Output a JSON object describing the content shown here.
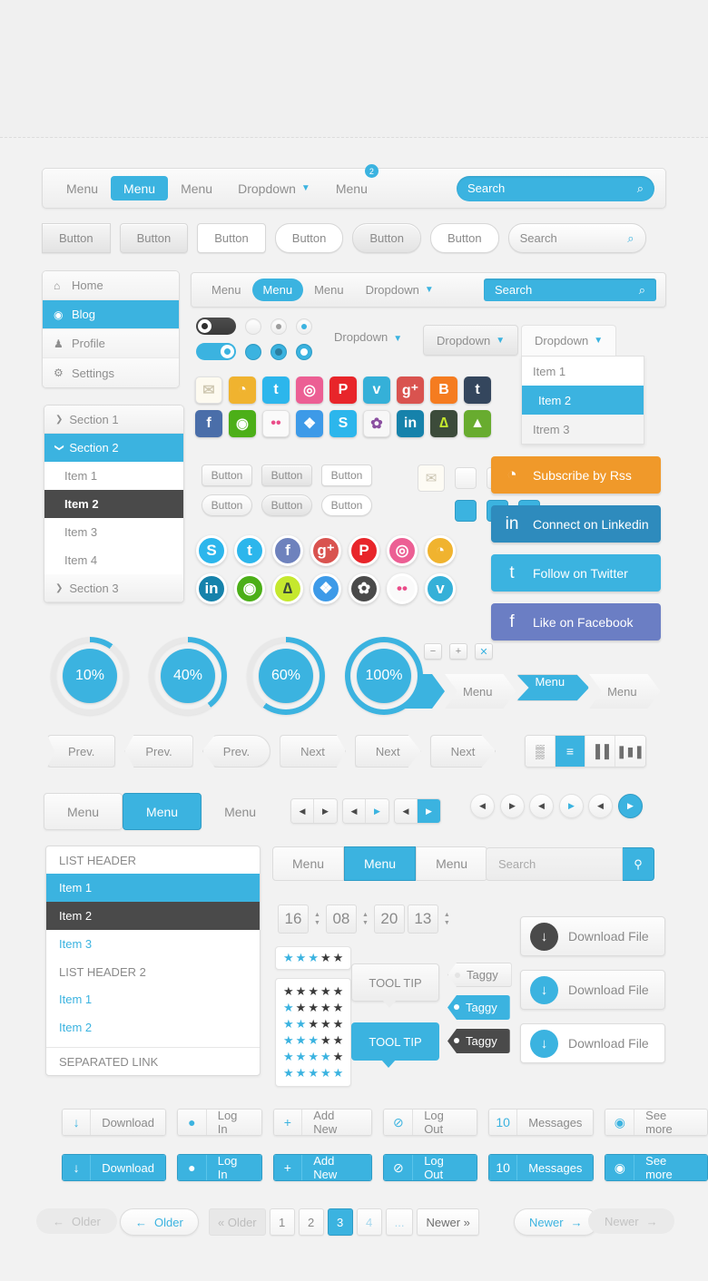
{
  "navbar_main": {
    "items": [
      {
        "label": "Menu",
        "active": false,
        "caret": false
      },
      {
        "label": "Menu",
        "active": true,
        "caret": false
      },
      {
        "label": "Menu",
        "active": false,
        "caret": false
      },
      {
        "label": "Dropdown",
        "active": false,
        "caret": true
      },
      {
        "label": "Menu",
        "active": false,
        "caret": false,
        "badge": "2"
      }
    ],
    "search_placeholder": "Search",
    "search_icon": "search-icon"
  },
  "button_row": {
    "buttons": [
      "Button",
      "Button",
      "Button",
      "Button",
      "Button",
      "Button"
    ],
    "search_placeholder": "Search"
  },
  "sidebar_menu": {
    "items": [
      {
        "label": "Home",
        "icon": "home-icon",
        "active": false
      },
      {
        "label": "Blog",
        "icon": "circle-dot-icon",
        "active": true
      },
      {
        "label": "Profile",
        "icon": "user-icon",
        "active": false
      },
      {
        "label": "Settings",
        "icon": "gear-icon",
        "active": false
      }
    ]
  },
  "sidebar_sections": {
    "rows": [
      {
        "type": "section",
        "label": "Section 1",
        "active": false,
        "arrow": "❯"
      },
      {
        "type": "section",
        "label": "Section 2",
        "active": true,
        "arrow": "❯"
      },
      {
        "type": "item",
        "label": "Item 1",
        "state": "normal"
      },
      {
        "type": "item",
        "label": "Item 2",
        "state": "dark"
      },
      {
        "type": "item",
        "label": "Item 3",
        "state": "normal"
      },
      {
        "type": "item",
        "label": "Item 4",
        "state": "normal"
      },
      {
        "type": "section",
        "label": "Section 3",
        "active": false,
        "arrow": "❯"
      }
    ]
  },
  "navbar_second": {
    "items": [
      {
        "label": "Menu",
        "active": false,
        "caret": false
      },
      {
        "label": "Menu",
        "active": true,
        "caret": false
      },
      {
        "label": "Menu",
        "active": false,
        "caret": false
      },
      {
        "label": "Dropdown",
        "active": false,
        "caret": true
      }
    ],
    "search_placeholder": "Search"
  },
  "dropdowns": {
    "plain_label": "Dropdown",
    "button_label": "Dropdown",
    "open_label": "Dropdown",
    "items": [
      {
        "label": "Item 1",
        "active": false
      },
      {
        "label": "Item 2",
        "active": true
      },
      {
        "label": "Itrem 3",
        "active": false
      }
    ]
  },
  "social_square": {
    "row1": [
      {
        "name": "email-icon",
        "glyph": "✉",
        "color": "#fdfaf0",
        "fg": "#cfc8b2"
      },
      {
        "name": "rss-icon",
        "glyph": "◔",
        "color": "#f0b32f",
        "fg": "#ffffff"
      },
      {
        "name": "twitter-icon",
        "glyph": "t",
        "color": "#2cb6ec",
        "fg": "#ffffff"
      },
      {
        "name": "dribbble-icon",
        "glyph": "◎",
        "color": "#ec5f94",
        "fg": "#ffffff"
      },
      {
        "name": "pinterest-icon",
        "glyph": "P",
        "color": "#e8252a",
        "fg": "#ffffff"
      },
      {
        "name": "vimeo-icon",
        "glyph": "v",
        "color": "#35b0d8",
        "fg": "#ffffff"
      },
      {
        "name": "google-plus-icon",
        "glyph": "g⁺",
        "color": "#d9534f",
        "fg": "#ffffff"
      },
      {
        "name": "blogger-icon",
        "glyph": "B",
        "color": "#f57c20",
        "fg": "#ffffff"
      },
      {
        "name": "tumblr-icon",
        "glyph": "t",
        "color": "#34465d",
        "fg": "#ffffff"
      }
    ],
    "row2": [
      {
        "name": "facebook-icon",
        "glyph": "f",
        "color": "#4a6ea9",
        "fg": "#ffffff"
      },
      {
        "name": "evernote-icon",
        "glyph": "◉",
        "color": "#4caf18",
        "fg": "#ffffff"
      },
      {
        "name": "flickr-icon",
        "glyph": "••",
        "color": "#fafafa",
        "fg": "#ea4c89"
      },
      {
        "name": "dropbox-icon",
        "glyph": "❖",
        "color": "#3d9ae8",
        "fg": "#ffffff"
      },
      {
        "name": "skype-icon",
        "glyph": "S",
        "color": "#2cb6ec",
        "fg": "#ffffff"
      },
      {
        "name": "picasa-icon",
        "glyph": "✿",
        "color": "#f7f7f7",
        "fg": "#8a4fa0"
      },
      {
        "name": "linkedin-icon",
        "glyph": "in",
        "color": "#1682ab",
        "fg": "#ffffff"
      },
      {
        "name": "deviantart-icon",
        "glyph": "∆",
        "color": "#3c4b3a",
        "fg": "#c5e82e"
      },
      {
        "name": "forrst-icon",
        "glyph": "▲",
        "color": "#68ac2f",
        "fg": "#ffffff"
      }
    ]
  },
  "mid_buttons": {
    "row1": [
      "Button",
      "Button",
      "Button"
    ],
    "row2": [
      "Button",
      "Button",
      "Button"
    ]
  },
  "checkboxes": {
    "row1": [
      {
        "name": "checkbox-empty",
        "glyph": "",
        "style": "empty"
      },
      {
        "name": "checkbox-cross-gray",
        "glyph": "✖",
        "style": "gx"
      },
      {
        "name": "checkbox-check-blue",
        "glyph": "✔",
        "style": "gv"
      }
    ],
    "row2": [
      {
        "name": "checkbox-filled-blue",
        "glyph": "",
        "style": "bfull"
      },
      {
        "name": "checkbox-cross-white",
        "glyph": "✖",
        "style": "bx"
      },
      {
        "name": "checkbox-check-white",
        "glyph": "✔",
        "style": "bv"
      }
    ]
  },
  "social_round": {
    "row1": [
      {
        "name": "skype-icon",
        "glyph": "S",
        "color": "#2cb6ec"
      },
      {
        "name": "twitter-icon",
        "glyph": "t",
        "color": "#2cb6ec"
      },
      {
        "name": "facebook-icon",
        "glyph": "f",
        "color": "#6e82bd"
      },
      {
        "name": "google-plus-icon",
        "glyph": "g⁺",
        "color": "#d9534f"
      },
      {
        "name": "pinterest-icon",
        "glyph": "P",
        "color": "#e8252a"
      },
      {
        "name": "dribbble-icon",
        "glyph": "◎",
        "color": "#ec5f94"
      },
      {
        "name": "rss-icon",
        "glyph": "◔",
        "color": "#f0b32f"
      }
    ],
    "row2": [
      {
        "name": "linkedin-icon",
        "glyph": "in",
        "color": "#1682ab"
      },
      {
        "name": "evernote-icon",
        "glyph": "◉",
        "color": "#4caf18"
      },
      {
        "name": "deviantart-icon",
        "glyph": "∆",
        "color": "#c5e82e"
      },
      {
        "name": "dropbox-icon",
        "glyph": "❖",
        "color": "#3d9ae8"
      },
      {
        "name": "picasa-icon",
        "glyph": "✿",
        "color": "#4a4a4a"
      },
      {
        "name": "flickr-icon",
        "glyph": "••",
        "color": "#fafafa"
      },
      {
        "name": "vimeo-icon",
        "glyph": "v",
        "color": "#35b0d8"
      }
    ]
  },
  "social_cta": [
    {
      "label": "Subscribe by Rss",
      "icon": "rss-icon",
      "glyph": "◔",
      "color": "#f0992a"
    },
    {
      "label": "Connect on Linkedin",
      "icon": "linkedin-icon",
      "glyph": "in",
      "color": "#2e8bbd"
    },
    {
      "label": "Follow on Twitter",
      "icon": "twitter-icon",
      "glyph": "t",
      "color": "#3bb3e0"
    },
    {
      "label": "Like on Facebook",
      "icon": "facebook-icon",
      "glyph": "f",
      "color": "#6b7ec4"
    }
  ],
  "progress_circles": [
    {
      "label": "10%",
      "value": 10
    },
    {
      "label": "40%",
      "value": 40
    },
    {
      "label": "60%",
      "value": 60
    },
    {
      "label": "100%",
      "value": 100
    }
  ],
  "plus_minus": [
    {
      "name": "minus-button",
      "glyph": "−"
    },
    {
      "name": "plus-button",
      "glyph": "+"
    },
    {
      "name": "close-button",
      "glyph": "✕"
    }
  ],
  "breadcrumbs": [
    {
      "label": "",
      "active": true
    },
    {
      "label": "Menu",
      "active": false
    },
    {
      "label": "Menu",
      "active": true
    },
    {
      "label": "Menu",
      "active": false
    }
  ],
  "prev_next": [
    "Prev.",
    "Prev.",
    "Prev.",
    "Next",
    "Next",
    "Next"
  ],
  "view_switcher": [
    {
      "name": "grid-view-icon",
      "glyph": "▒",
      "active": false
    },
    {
      "name": "list-view-icon",
      "glyph": "≡",
      "active": true
    },
    {
      "name": "column-view-icon",
      "glyph": "▐▐",
      "active": false
    },
    {
      "name": "gallery-view-icon",
      "glyph": "❚▮❚",
      "active": false
    }
  ],
  "menu_tabs": [
    {
      "label": "Menu",
      "active": false,
      "plain": false
    },
    {
      "label": "Menu",
      "active": true,
      "plain": false
    },
    {
      "label": "Menu",
      "active": false,
      "plain": true
    }
  ],
  "arrow_pairs": [
    {
      "left_glyph": "◀",
      "right_glyph": "▶",
      "right_style": "dark"
    },
    {
      "left_glyph": "◀",
      "right_glyph": "▶",
      "right_style": "blue"
    },
    {
      "left_glyph": "◀",
      "right_glyph": "▶",
      "right_style": "fill"
    }
  ],
  "round_arrows": [
    {
      "left_glyph": "◀",
      "right_glyph": "▶",
      "right_style": "dark"
    },
    {
      "left_glyph": "◀",
      "right_glyph": "▶",
      "right_style": "blue"
    },
    {
      "left_glyph": "◀",
      "right_glyph": "▶",
      "right_style": "fill"
    }
  ],
  "list_panel": [
    {
      "label": "LIST HEADER",
      "type": "header"
    },
    {
      "label": "Item 1",
      "type": "selected"
    },
    {
      "label": "Item 2",
      "type": "dark"
    },
    {
      "label": "Item 3",
      "type": "link"
    },
    {
      "label": "LIST HEADER 2",
      "type": "header"
    },
    {
      "label": "Item 1",
      "type": "link"
    },
    {
      "label": "Item 2",
      "type": "link"
    },
    {
      "label": "SEPARATED LINK",
      "type": "separated"
    }
  ],
  "list_tabs": [
    {
      "label": "Menu",
      "active": false
    },
    {
      "label": "Menu",
      "active": true
    },
    {
      "label": "Menu",
      "active": false
    }
  ],
  "list_search": {
    "placeholder": "Search",
    "icon": "search-icon"
  },
  "spinners": {
    "fields": [
      "16",
      "08",
      "20",
      "13"
    ],
    "up_glyph": "▲",
    "down_glyph": "▼"
  },
  "stars": {
    "top_row": [
      true,
      true,
      true,
      false,
      false
    ],
    "rows": [
      [
        false,
        false,
        false,
        false,
        false
      ],
      [
        true,
        false,
        false,
        false,
        false
      ],
      [
        true,
        true,
        false,
        false,
        false
      ],
      [
        true,
        true,
        true,
        false,
        false
      ],
      [
        true,
        true,
        true,
        true,
        false
      ],
      [
        true,
        true,
        true,
        true,
        true
      ]
    ],
    "glyph": "★"
  },
  "tooltips": [
    {
      "label": "TOOL TIP",
      "style": "light"
    },
    {
      "label": "TOOL TIP",
      "style": "dark"
    }
  ],
  "tags": [
    {
      "label": "Taggy",
      "style": "light"
    },
    {
      "label": "Taggy",
      "style": "blue"
    },
    {
      "label": "Taggy",
      "style": "dark"
    }
  ],
  "download_buttons": [
    {
      "label": "Download File",
      "icon": "download-icon",
      "glyph": "↓",
      "style": "dark"
    },
    {
      "label": "Download File",
      "icon": "download-icon",
      "glyph": "↓",
      "style": "blue"
    },
    {
      "label": "Download File",
      "icon": "download-icon",
      "glyph": "↓",
      "style": "blue"
    }
  ],
  "action_buttons": [
    {
      "label": "Download",
      "icon": "download-icon",
      "glyph": "↓"
    },
    {
      "label": "Log In",
      "icon": "user-icon",
      "glyph": "●"
    },
    {
      "label": "Add New",
      "icon": "plus-circle-icon",
      "glyph": "+"
    },
    {
      "label": "Log Out",
      "icon": "power-icon",
      "glyph": "⊘"
    },
    {
      "label": "Messages",
      "icon": "count-badge",
      "glyph": "10"
    },
    {
      "label": "See more",
      "icon": "eye-icon",
      "glyph": "◉"
    }
  ],
  "bottom_pagination": {
    "older_disabled": {
      "label": "Older",
      "arrow": "←"
    },
    "older_active": {
      "label": "Older",
      "arrow": "←"
    },
    "pages": [
      {
        "label": "« Older",
        "style": "muted"
      },
      {
        "label": "1",
        "style": "normal"
      },
      {
        "label": "2",
        "style": "normal"
      },
      {
        "label": "3",
        "style": "active"
      },
      {
        "label": "4",
        "style": "lnk"
      },
      {
        "label": "...",
        "style": "lnk"
      },
      {
        "label": "Newer »",
        "style": "txt"
      }
    ],
    "newer_active": {
      "label": "Newer",
      "arrow": "→"
    },
    "newer_disabled": {
      "label": "Newer",
      "arrow": "→"
    }
  },
  "colors": {
    "accent": "#3bb3e0",
    "dark": "#4a4a4a",
    "bg": "#f2f2f2",
    "orange": "#f0992a",
    "facebook": "#6b7ec4",
    "linkedin": "#2e8bbd"
  }
}
